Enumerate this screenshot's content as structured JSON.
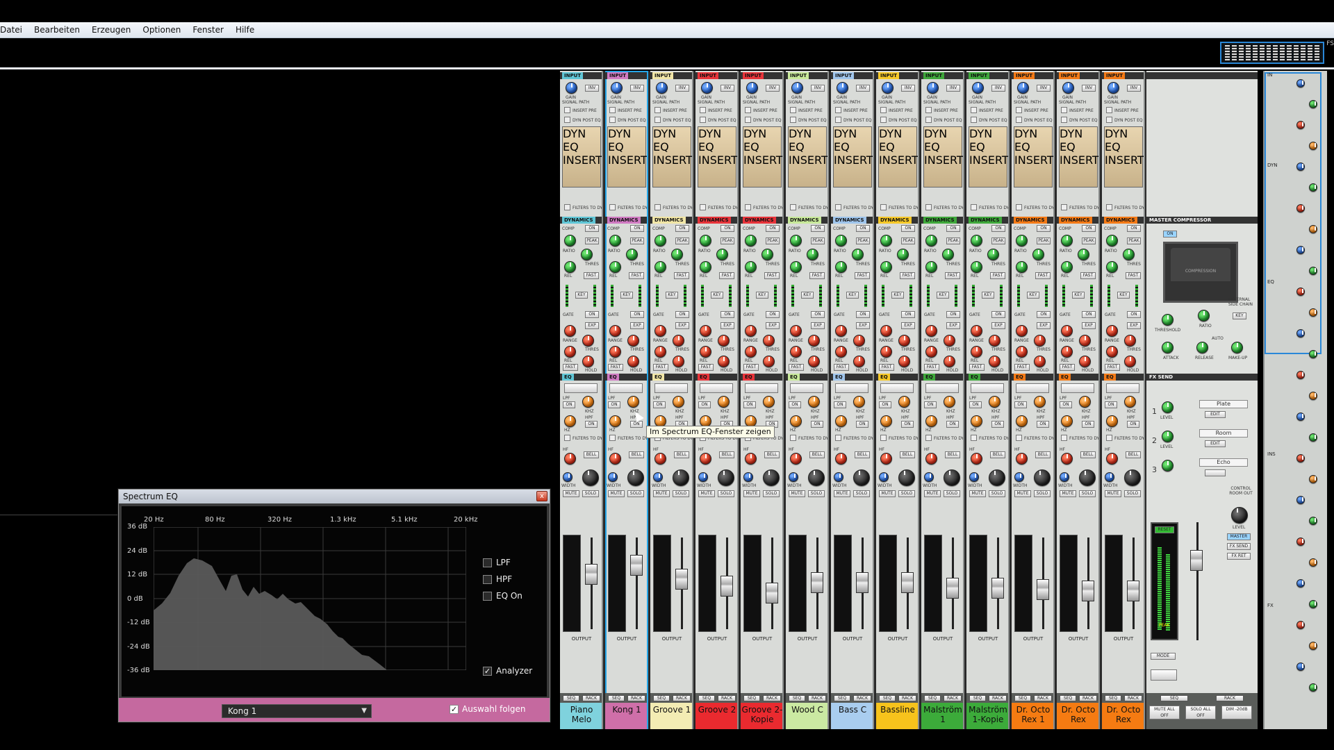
{
  "menu": [
    "Datei",
    "Bearbeiten",
    "Erzeugen",
    "Optionen",
    "Fenster",
    "Hilfe"
  ],
  "right_stub": "FS",
  "section_labels": {
    "input": "INPUT",
    "inv": "INV",
    "gain": "GAIN",
    "signal_path": "SIGNAL PATH",
    "insert_pre": "INSERT PRE",
    "dyn_post_eq": "DYN POST EQ",
    "sp_dyn": "DYN",
    "sp_eq": "EQ",
    "sp_insert": "INSERT",
    "filters_dyn_sc": "FILTERS TO DYN S/C",
    "dynamics": "DYNAMICS",
    "comp": "COMP",
    "on": "ON",
    "peak": "PEAK",
    "ratio": "RATIO",
    "thres": "THRES",
    "rel": "REL",
    "fast": "FAST",
    "key": "KEY",
    "gate": "GATE",
    "exp": "EXP",
    "range": "RANGE",
    "hold": "HOLD",
    "eq": "EQ",
    "lpf": "LPF",
    "hpf": "HPF",
    "khz": "KHZ",
    "hz": "HZ",
    "hf": "HF",
    "bell": "BELL",
    "width": "WIDTH",
    "mute": "MUTE",
    "solo": "SOLO",
    "output": "OUTPUT",
    "seq": "SEQ",
    "rack": "RACK"
  },
  "channels": [
    {
      "name": "Piano Melo",
      "color": "#5fc6d6",
      "name_bg": "#7fd2dd",
      "meter": 0.28,
      "fader": 0.38
    },
    {
      "name": "Kong 1",
      "color": "#d07ac2",
      "name_bg": "#cf6fa9",
      "meter": 0.45,
      "fader": 0.25
    },
    {
      "name": "Groove 1",
      "color": "#f1e6a6",
      "name_bg": "#f3ecb3",
      "meter": 0.25,
      "fader": 0.45
    },
    {
      "name": "Groove 2",
      "color": "#e8343a",
      "name_bg": "#ea2a2f",
      "meter": 0.22,
      "fader": 0.55
    },
    {
      "name": "Groove 2-Kopie",
      "color": "#e8343a",
      "name_bg": "#ea2a2f",
      "meter": 0.16,
      "fader": 0.65
    },
    {
      "name": "Wood C",
      "color": "#c8e99a",
      "name_bg": "#cbe9a2",
      "meter": 0.12,
      "fader": 0.5
    },
    {
      "name": "Bass C",
      "color": "#9fc5ec",
      "name_bg": "#a9cdef",
      "meter": 0.2,
      "fader": 0.5
    },
    {
      "name": "Bassline",
      "color": "#f7c928",
      "name_bg": "#f7c31c",
      "meter": 0.26,
      "fader": 0.5
    },
    {
      "name": "Malström 1",
      "color": "#3fa83b",
      "name_bg": "#3cab3a",
      "meter": 0.2,
      "fader": 0.58
    },
    {
      "name": "Malström 1-Kopie",
      "color": "#3fa83b",
      "name_bg": "#3cab3a",
      "meter": 0.18,
      "fader": 0.58
    },
    {
      "name": "Dr. Octo Rex 1",
      "color": "#f47a16",
      "name_bg": "#f57b12",
      "meter": 0.22,
      "fader": 0.6
    },
    {
      "name": "Dr. Octo Rex",
      "color": "#f47a16",
      "name_bg": "#f57b12",
      "meter": 0.2,
      "fader": 0.62
    },
    {
      "name": "Dr. Octo Rex",
      "color": "#f47a16",
      "name_bg": "#f57b12",
      "meter": 0.18,
      "fader": 0.62
    }
  ],
  "selected_channel": "Kong 1",
  "master": {
    "compressor_title": "MASTER COMPRESSOR",
    "on": "ON",
    "vu_label": "COMPRESSION",
    "threshold": "THRESHOLD",
    "ratio": "RATIO",
    "attack": "ATTACK",
    "release": "RELEASE",
    "makeup": "MAKE-UP",
    "auto": "AUTO",
    "external_sc": "EXTERNAL SIDE CHAIN",
    "key": "KEY",
    "fx_send": "FX SEND",
    "fx_slots": [
      {
        "num": "1",
        "name": "Plate",
        "edit": "EDIT",
        "level": "LEVEL"
      },
      {
        "num": "2",
        "name": "Room",
        "edit": "EDIT",
        "level": "LEVEL"
      },
      {
        "num": "3",
        "name": "Echo",
        "edit": "",
        "level": ""
      }
    ],
    "control_room_out": "CONTROL ROOM OUT",
    "level": "LEVEL",
    "buttons": [
      "MASTER",
      "FX SEND",
      "FX RET"
    ],
    "reset": "RESET",
    "peak": "PEAK",
    "mode": "MODE",
    "footer": {
      "seq": "SEQ",
      "rack": "RACK",
      "mute_all_off": "MUTE ALL OFF",
      "solo_all_off": "SOLO ALL OFF",
      "dim": "DIM -20dB"
    }
  },
  "rightcol_labels": [
    "IN",
    "DYN",
    "EQ",
    "INS",
    "FX"
  ],
  "spectrum_eq": {
    "title": "Spectrum EQ",
    "close": "x",
    "freq_labels": [
      "20 Hz",
      "80 Hz",
      "320 Hz",
      "1.3 kHz",
      "5.1 kHz",
      "20 kHz"
    ],
    "db_labels": [
      "36 dB",
      "24 dB",
      "12 dB",
      "0 dB",
      "-12 dB",
      "-24 dB",
      "-36 dB"
    ],
    "lpf": "LPF",
    "hpf": "HPF",
    "eq_on": "EQ On",
    "analyzer": "Analyzer",
    "analyzer_checked": "✓",
    "device": "Kong 1",
    "follow": "Auswahl folgen",
    "follow_checked": "✓"
  },
  "tooltip": "Im Spectrum EQ-Fenster zeigen"
}
